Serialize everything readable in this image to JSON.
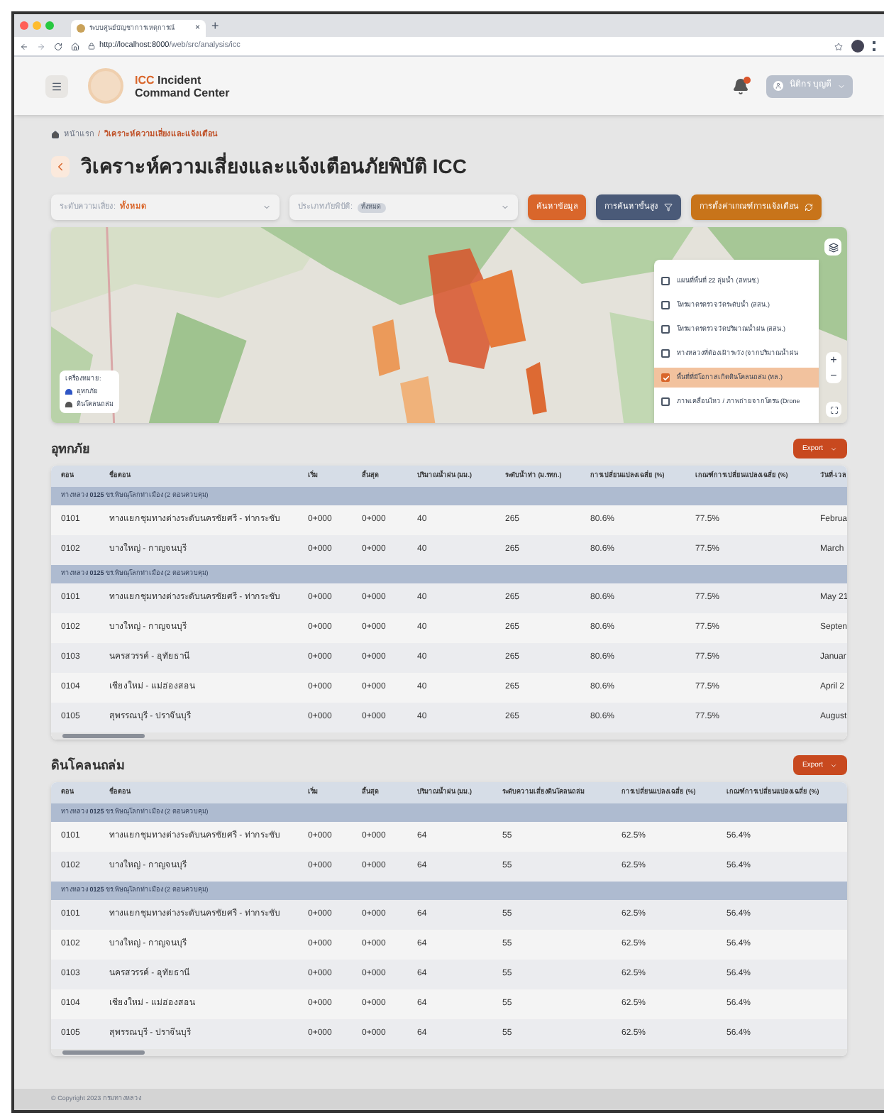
{
  "browser": {
    "tab_title": "ระบบศูนย์บัญชาการเหตุการณ์",
    "tab_close": "×",
    "new_tab": "+",
    "url_host": "http://localhost:8000",
    "url_path": "/web/src/analysis/icc"
  },
  "header": {
    "brand_accent": "ICC",
    "brand_rest": " Incident",
    "brand_line2": "Command Center",
    "notification_unread": true,
    "user": "นิติกร บุญดี"
  },
  "breadcrumb": [
    {
      "label": "หน้าแรก",
      "current": false
    },
    {
      "label": "วิเคราะห์ความเสี่ยงและแจ้งเตือน",
      "current": true
    }
  ],
  "breadcrumb_separator": "/",
  "title": "วิเคราะห์ความเสี่ยงและแจ้งเตือนภัยพิบัติ ICC",
  "filters": [
    {
      "kind": "text",
      "label": "ระดับความเสี่ยง:",
      "value": "ทั้งหมด"
    },
    {
      "kind": "chip",
      "label": "ประเภทภัยพิบัติ:",
      "value": "ทั้งหมด"
    }
  ],
  "actions": [
    {
      "label": "ค้นหาข้อมูล",
      "kind": "plain",
      "color": "#d9662b"
    },
    {
      "label": "การค้นหาขั้นสูง",
      "kind": "filter",
      "color": "#4a5a78"
    },
    {
      "label": "การตั้งค่าเกณฑ์การแจ้งเตือน",
      "kind": "refresh",
      "color": "#c8741a"
    }
  ],
  "map": {
    "legend_title": "เครื่องหมาย:",
    "legend": [
      {
        "label": "อุทกภัย",
        "color": "#2f56c6"
      },
      {
        "label": "ดินโคลนถล่ม",
        "color": "#555555"
      }
    ],
    "layers": [
      {
        "label": "แผนที่พื้นที่ 22 ลุ่มน้ำ (สทนช.)",
        "checked": false
      },
      {
        "label": "โทรมาตรตรวจวัดระดับน้ำ (สสน.)",
        "checked": false
      },
      {
        "label": "โทรมาตรตรวจวัดปริมาณน้ำฝน (สสน.)",
        "checked": false
      },
      {
        "label": "ทางหลวงที่ต้องเฝ้าระวัง (จากปริมาณน้ำฝน",
        "checked": false
      },
      {
        "label": "พื้นที่ที่มีโอกาสเกิดดินโคลนถล่ม (ทล.)",
        "checked": true
      },
      {
        "label": "ภาพเคลื่อนไหว / ภาพถ่ายจากโดรน (Drone",
        "checked": false
      }
    ],
    "zoom_in": "+",
    "zoom_out": "−"
  },
  "tables": [
    {
      "title": "อุทกภัย",
      "export": "Export",
      "columns": [
        "ตอน",
        "ชื่อตอน",
        "เริ่ม",
        "สิ้นสุด",
        "ปริมาณน้ำฝน (มม.)",
        "ระดับน้ำท่า (ม.รทก.)",
        "การเปลี่ยนแปลงเฉลี่ย (%)",
        "เกณฑ์การเปลี่ยนแปลงเฉลี่ย (%)",
        "วันที่-เวล"
      ],
      "rows": [
        {
          "kind": "group",
          "label": "ทางหลวง",
          "code": "0125",
          "text": "ขร.พิษณุโลกท่าเมือง (2 ตอนควบคุม)"
        },
        {
          "kind": "row",
          "cells": [
            "0101",
            "ทางแยกชุมทางต่างระดับนครชัยศรี - ท่ากระชับ",
            "0+000",
            "0+000",
            "40",
            "265",
            "80.6%",
            "77.5%",
            "Februa"
          ]
        },
        {
          "kind": "row",
          "cells": [
            "0102",
            "บางใหญ่ - กาญจนบุรี",
            "0+000",
            "0+000",
            "40",
            "265",
            "80.6%",
            "77.5%",
            "March"
          ]
        },
        {
          "kind": "group",
          "label": "ทางหลวง",
          "code": "0125",
          "text": "ขร.พิษณุโลกท่าเมือง (2 ตอนควบคุม)"
        },
        {
          "kind": "row",
          "cells": [
            "0101",
            "ทางแยกชุมทางต่างระดับนครชัยศรี - ท่ากระชับ",
            "0+000",
            "0+000",
            "40",
            "265",
            "80.6%",
            "77.5%",
            "May 21"
          ]
        },
        {
          "kind": "row",
          "cells": [
            "0102",
            "บางใหญ่ - กาญจนบุรี",
            "0+000",
            "0+000",
            "40",
            "265",
            "80.6%",
            "77.5%",
            "Septen"
          ]
        },
        {
          "kind": "row",
          "cells": [
            "0103",
            "นครสวรรค์ - อุทัยธานี",
            "0+000",
            "0+000",
            "40",
            "265",
            "80.6%",
            "77.5%",
            "Januar"
          ]
        },
        {
          "kind": "row",
          "cells": [
            "0104",
            "เชียงใหม่ - แม่ฮ่องสอน",
            "0+000",
            "0+000",
            "40",
            "265",
            "80.6%",
            "77.5%",
            "April 2"
          ]
        },
        {
          "kind": "row",
          "cells": [
            "0105",
            "สุพรรณบุรี - ปราจีนบุรี",
            "0+000",
            "0+000",
            "40",
            "265",
            "80.6%",
            "77.5%",
            "August"
          ]
        }
      ]
    },
    {
      "title": "ดินโคลนถล่ม",
      "export": "Export",
      "columns": [
        "ตอน",
        "ชื่อตอน",
        "เริ่ม",
        "สิ้นสุด",
        "ปริมาณน้ำฝน (มม.)",
        "ระดับความเสี่ยงดินโคลนถล่ม",
        "การเปลี่ยนแปลงเฉลี่ย (%)",
        "เกณฑ์การเปลี่ยนแปลงเฉลี่ย (%)"
      ],
      "rows": [
        {
          "kind": "group",
          "label": "ทางหลวง",
          "code": "0125",
          "text": "ขร.พิษณุโลกท่าเมือง (2 ตอนควบคุม)"
        },
        {
          "kind": "row",
          "cells": [
            "0101",
            "ทางแยกชุมทางต่างระดับนครชัยศรี - ท่ากระชับ",
            "0+000",
            "0+000",
            "64",
            "55",
            "62.5%",
            "56.4%"
          ]
        },
        {
          "kind": "row",
          "cells": [
            "0102",
            "บางใหญ่ - กาญจนบุรี",
            "0+000",
            "0+000",
            "64",
            "55",
            "62.5%",
            "56.4%"
          ]
        },
        {
          "kind": "group",
          "label": "ทางหลวง",
          "code": "0125",
          "text": "ขร.พิษณุโลกท่าเมือง (2 ตอนควบคุม)"
        },
        {
          "kind": "row",
          "cells": [
            "0101",
            "ทางแยกชุมทางต่างระดับนครชัยศรี - ท่ากระชับ",
            "0+000",
            "0+000",
            "64",
            "55",
            "62.5%",
            "56.4%"
          ]
        },
        {
          "kind": "row",
          "cells": [
            "0102",
            "บางใหญ่ - กาญจนบุรี",
            "0+000",
            "0+000",
            "64",
            "55",
            "62.5%",
            "56.4%"
          ]
        },
        {
          "kind": "row",
          "cells": [
            "0103",
            "นครสวรรค์ - อุทัยธานี",
            "0+000",
            "0+000",
            "64",
            "55",
            "62.5%",
            "56.4%"
          ]
        },
        {
          "kind": "row",
          "cells": [
            "0104",
            "เชียงใหม่ - แม่ฮ่องสอน",
            "0+000",
            "0+000",
            "64",
            "55",
            "62.5%",
            "56.4%"
          ]
        },
        {
          "kind": "row",
          "cells": [
            "0105",
            "สุพรรณบุรี - ปราจีนบุรี",
            "0+000",
            "0+000",
            "64",
            "55",
            "62.5%",
            "56.4%"
          ]
        }
      ]
    }
  ],
  "footer": "© Copyright 2023 กรมทางหลวง"
}
